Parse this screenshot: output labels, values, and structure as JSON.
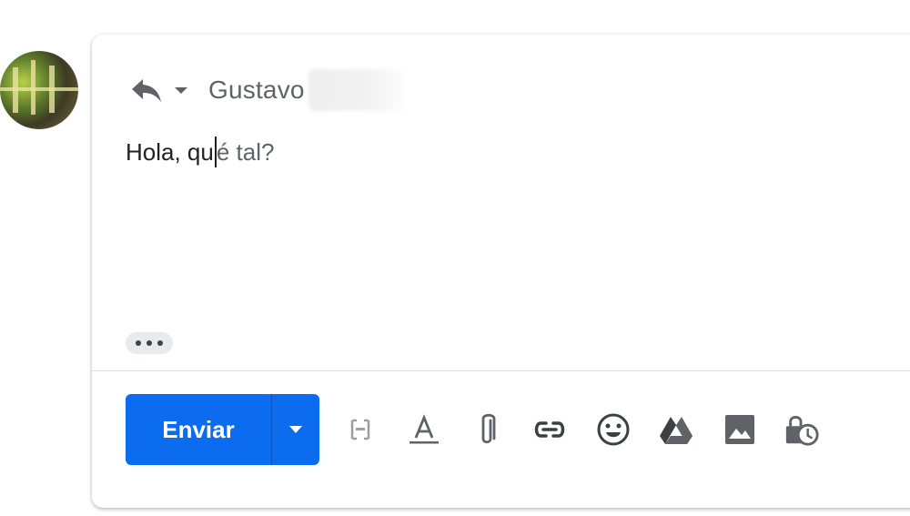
{
  "header": {
    "recipient_name": "Gustavo"
  },
  "message": {
    "typed_text": "Hola, qu",
    "suggestion_text": "é tal?"
  },
  "actions": {
    "send_label": "Enviar"
  },
  "toolbar": {
    "icons": [
      "smart-compose-icon",
      "format-text-icon",
      "attach-file-icon",
      "insert-link-icon",
      "emoji-icon",
      "google-drive-icon",
      "insert-photo-icon",
      "confidential-mode-icon"
    ]
  },
  "colors": {
    "send_button": "#0b6cf0",
    "icon_gray": "#5f6368",
    "text": "#222222"
  }
}
